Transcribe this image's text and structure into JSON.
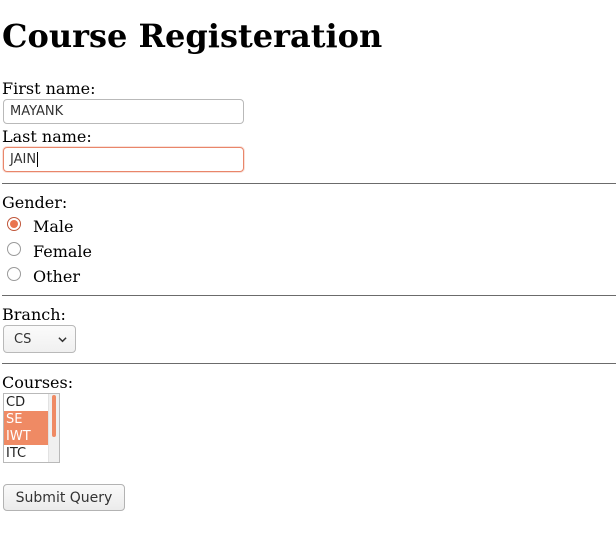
{
  "title": "Course Registeration",
  "first_name": {
    "label": "First name:",
    "value": "MAYANK"
  },
  "last_name": {
    "label": "Last name:",
    "value": "JAIN"
  },
  "gender": {
    "label": "Gender:",
    "options": [
      "Male",
      "Female",
      "Other"
    ],
    "selected": "Male"
  },
  "branch": {
    "label": "Branch:",
    "selected": "CS"
  },
  "courses": {
    "label": "Courses:",
    "options": [
      "CD",
      "SE",
      "IWT",
      "ITC"
    ],
    "selected": [
      "SE",
      "IWT"
    ]
  },
  "submit_label": "Submit Query",
  "colors": {
    "accent": "#ef8a64",
    "focus_border": "#e9866a",
    "separator": "#6b6b6b"
  },
  "icons": {
    "select_arrow": "chevron-down-icon"
  }
}
